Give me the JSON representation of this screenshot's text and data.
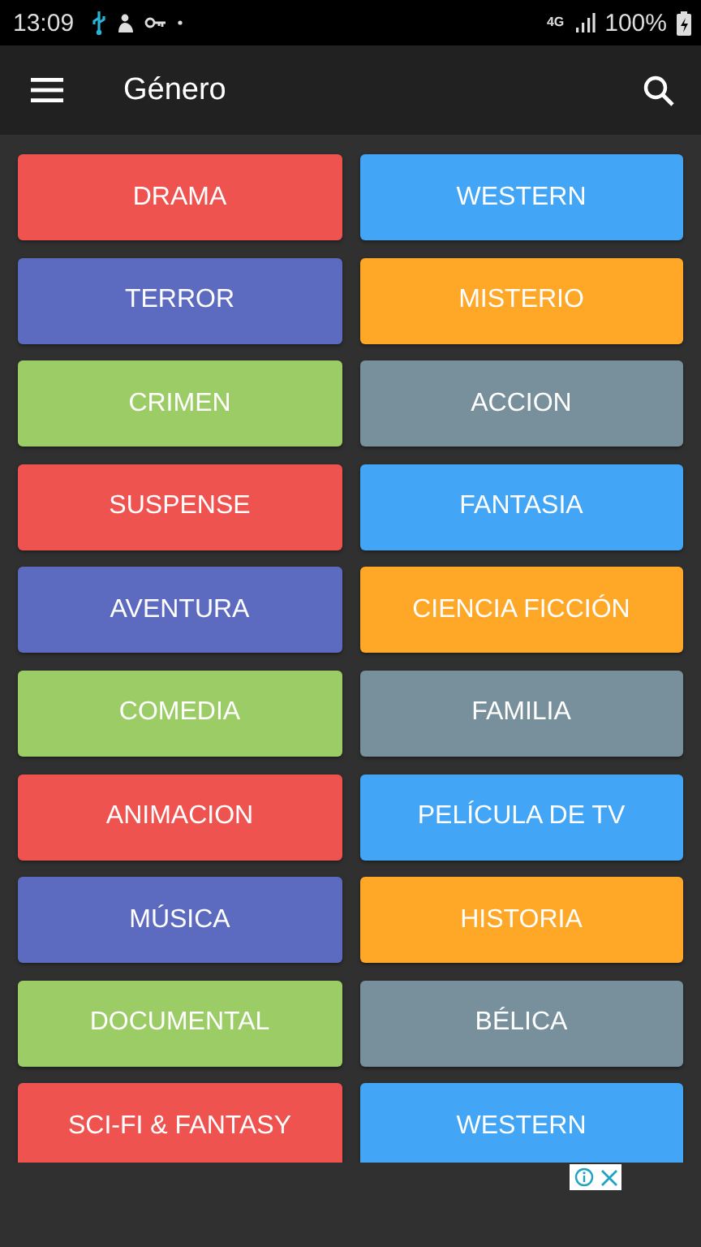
{
  "status_bar": {
    "time": "13:09",
    "network": "4G",
    "battery": "100%"
  },
  "app_bar": {
    "title": "Género"
  },
  "genres": [
    {
      "label": "DRAMA",
      "color": "#ef5350"
    },
    {
      "label": "WESTERN",
      "color": "#42a5f5"
    },
    {
      "label": "TERROR",
      "color": "#5c6bc0"
    },
    {
      "label": "MISTERIO",
      "color": "#ffa726"
    },
    {
      "label": "CRIMEN",
      "color": "#9ccc65"
    },
    {
      "label": "ACCION",
      "color": "#78909c"
    },
    {
      "label": "SUSPENSE",
      "color": "#ef5350"
    },
    {
      "label": "FANTASIA",
      "color": "#42a5f5"
    },
    {
      "label": "AVENTURA",
      "color": "#5c6bc0"
    },
    {
      "label": "CIENCIA FICCIÓN",
      "color": "#ffa726"
    },
    {
      "label": "COMEDIA",
      "color": "#9ccc65"
    },
    {
      "label": "FAMILIA",
      "color": "#78909c"
    },
    {
      "label": "ANIMACION",
      "color": "#ef5350"
    },
    {
      "label": "PELÍCULA DE TV",
      "color": "#42a5f5"
    },
    {
      "label": "MÚSICA",
      "color": "#5c6bc0"
    },
    {
      "label": "HISTORIA",
      "color": "#ffa726"
    },
    {
      "label": "DOCUMENTAL",
      "color": "#9ccc65"
    },
    {
      "label": "BÉLICA",
      "color": "#78909c"
    },
    {
      "label": "SCI-FI & FANTASY",
      "color": "#ef5350"
    },
    {
      "label": "WESTERN",
      "color": "#42a5f5"
    }
  ]
}
